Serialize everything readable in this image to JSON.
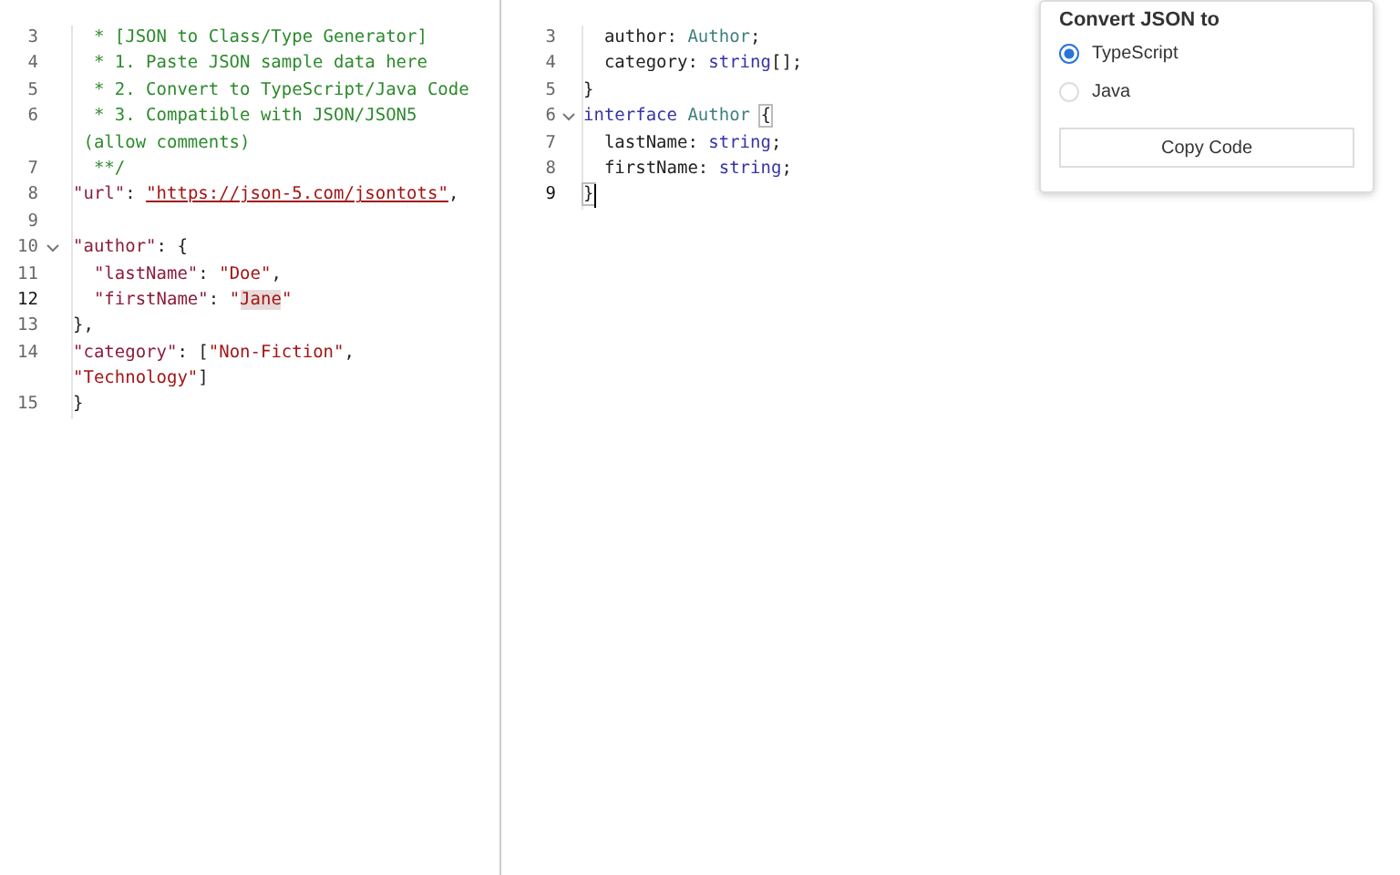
{
  "source_editor": {
    "lines": [
      {
        "number": "3",
        "tokens": [
          {
            "kind": "comment",
            "text": "  * [JSON to Class/Type Generator]"
          }
        ]
      },
      {
        "number": "4",
        "tokens": [
          {
            "kind": "comment",
            "text": "  * 1. Paste JSON sample data here"
          }
        ]
      },
      {
        "number": "5",
        "tokens": [
          {
            "kind": "comment",
            "text": "  * 2. Convert to TypeScript/Java Code"
          }
        ]
      },
      {
        "number": "6",
        "tokens": [
          {
            "kind": "comment",
            "text": "  * 3. Compatible with JSON/JSON5"
          }
        ]
      },
      {
        "tokens": [
          {
            "kind": "comment",
            "text": " (allow comments)"
          }
        ]
      },
      {
        "number": "7",
        "tokens": [
          {
            "kind": "comment",
            "text": "  **/"
          }
        ]
      },
      {
        "number": "8",
        "tokens": [
          {
            "kind": "key",
            "text": "\"url\""
          },
          {
            "kind": "punct",
            "text": ": "
          },
          {
            "kind": "link",
            "text": "\"https://json-5.com/jsontots\""
          },
          {
            "kind": "punct",
            "text": ","
          }
        ]
      },
      {
        "number": "9"
      },
      {
        "number": "10",
        "expanded": true,
        "tokens": [
          {
            "kind": "key",
            "text": "\"author\""
          },
          {
            "kind": "punct",
            "text": ": {"
          }
        ]
      },
      {
        "number": "11",
        "tokens": [
          {
            "kind": "key",
            "text": "  \"lastName\""
          },
          {
            "kind": "punct",
            "text": ": "
          },
          {
            "kind": "string",
            "text": "\"Doe\""
          },
          {
            "kind": "punct",
            "text": ","
          }
        ]
      },
      {
        "number": "12",
        "current": true,
        "tokens": [
          {
            "kind": "key",
            "text": "  \"firstName\""
          },
          {
            "kind": "punct",
            "text": ": "
          },
          {
            "kind": "string",
            "text": "\""
          },
          {
            "kind": "selected",
            "text": "Jane"
          },
          {
            "kind": "string",
            "text": "\""
          }
        ]
      },
      {
        "number": "13",
        "tokens": [
          {
            "kind": "punct",
            "text": "},"
          }
        ]
      },
      {
        "number": "14",
        "tokens": [
          {
            "kind": "key",
            "text": "\"category\""
          },
          {
            "kind": "punct",
            "text": ": ["
          },
          {
            "kind": "string",
            "text": "\"Non-Fiction\""
          },
          {
            "kind": "punct",
            "text": ","
          }
        ]
      },
      {
        "tokens": [
          {
            "kind": "string",
            "text": "\"Technology\""
          },
          {
            "kind": "punct",
            "text": "]"
          }
        ]
      },
      {
        "number": "15",
        "tokens": [
          {
            "kind": "punct",
            "text": "}"
          }
        ]
      }
    ]
  },
  "output_editor": {
    "lines": [
      {
        "number": "3",
        "tokens": [
          {
            "kind": "punct",
            "text": "  author: "
          },
          {
            "kind": "type",
            "text": "Author"
          },
          {
            "kind": "punct",
            "text": ";"
          }
        ]
      },
      {
        "number": "4",
        "tokens": [
          {
            "kind": "punct",
            "text": "  category: "
          },
          {
            "kind": "keyword",
            "text": "string"
          },
          {
            "kind": "punct",
            "text": "[];"
          }
        ]
      },
      {
        "number": "5",
        "tokens": [
          {
            "kind": "punct",
            "text": "}"
          }
        ]
      },
      {
        "number": "6",
        "expanded": true,
        "tokens": [
          {
            "kind": "keyword",
            "text": "interface "
          },
          {
            "kind": "type",
            "text": "Author "
          },
          {
            "kind": "bracket",
            "text": "{"
          }
        ]
      },
      {
        "number": "7",
        "tokens": [
          {
            "kind": "punct",
            "text": "  lastName: "
          },
          {
            "kind": "keyword",
            "text": "string"
          },
          {
            "kind": "punct",
            "text": ";"
          }
        ]
      },
      {
        "number": "8",
        "tokens": [
          {
            "kind": "punct",
            "text": "  firstName: "
          },
          {
            "kind": "keyword",
            "text": "string"
          },
          {
            "kind": "punct",
            "text": ";"
          }
        ]
      },
      {
        "number": "9",
        "current": true,
        "tokens": [
          {
            "kind": "bracket",
            "text": "}"
          }
        ]
      }
    ]
  },
  "convert_panel": {
    "title": "Convert JSON to",
    "options": [
      {
        "label": "TypeScript",
        "selected": true
      },
      {
        "label": "Java",
        "selected": false
      }
    ],
    "button": "Copy Code"
  }
}
